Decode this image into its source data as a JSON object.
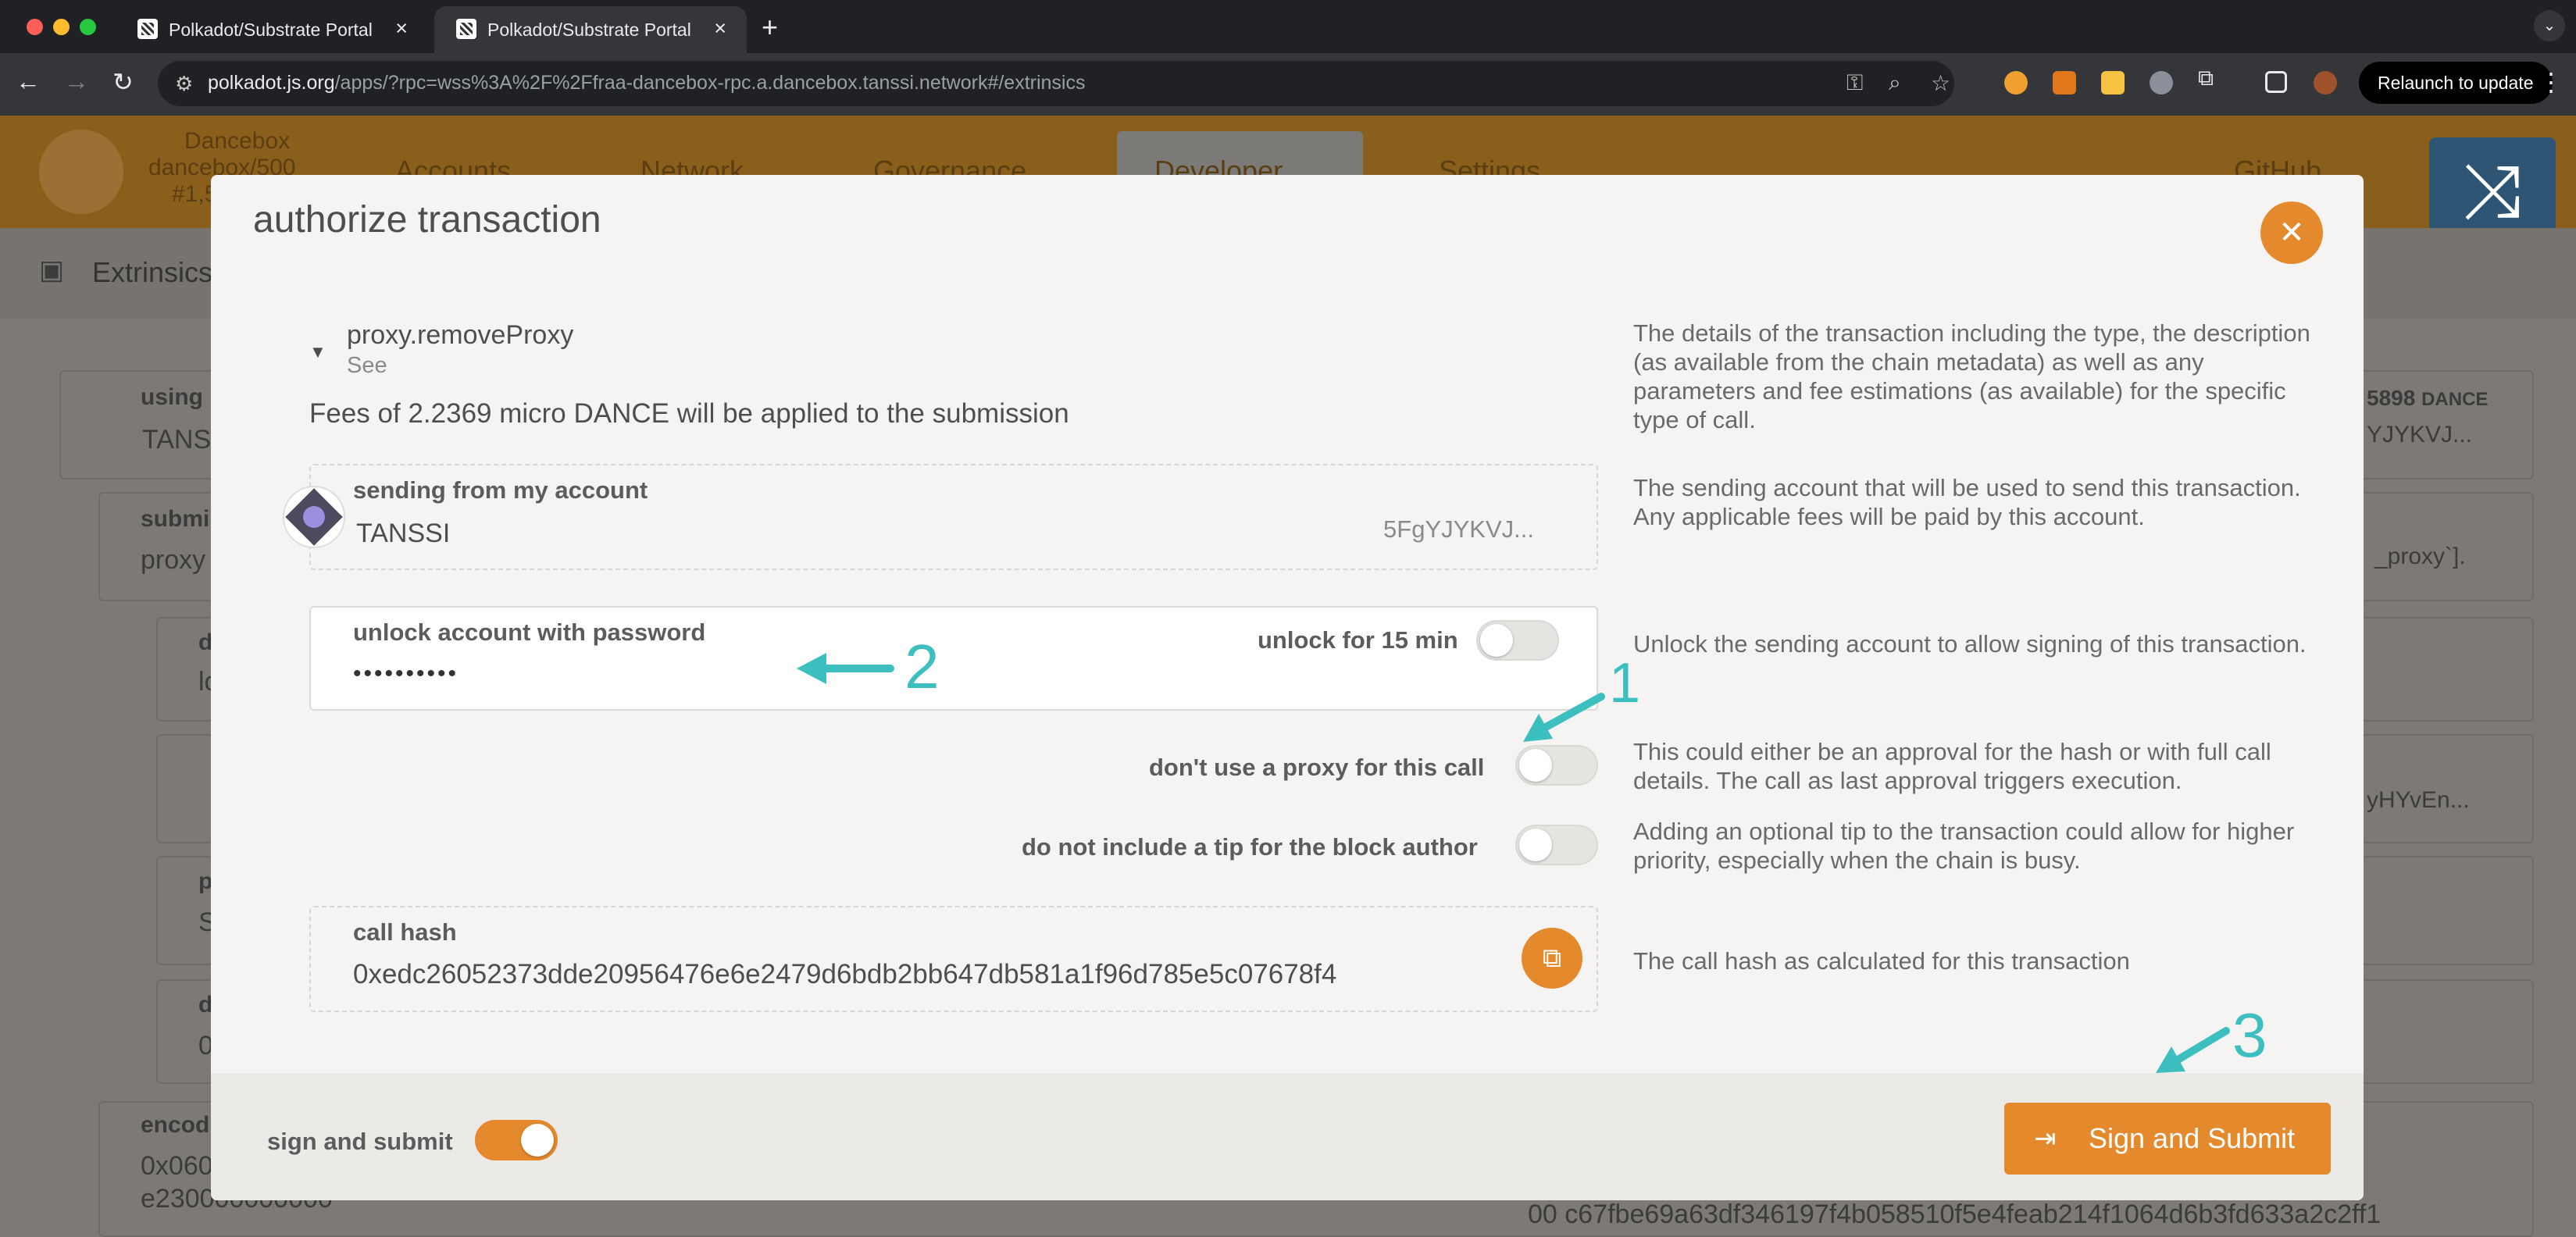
{
  "browser": {
    "tabs": [
      {
        "title": "Polkadot/Substrate Portal",
        "active": false
      },
      {
        "title": "Polkadot/Substrate Portal",
        "active": true
      }
    ],
    "url_host": "polkadot.js.org",
    "url_rest": "/apps/?rpc=wss%3A%2F%2Ffraa-dancebox-rpc.a.dancebox.tanssi.network#/extrinsics",
    "relaunch_label": "Relaunch to update"
  },
  "background_app": {
    "chain_name": "Dancebox",
    "chain_spec": "dancebox/500",
    "chain_block": "#1,5",
    "nav": [
      "Accounts",
      "Network",
      "Governance",
      "Developer",
      "Settings",
      "GitHub"
    ],
    "page_title": "Extrinsics",
    "using_label": "using",
    "using_value": "TANS",
    "balance": "5898",
    "balance_unit": "DANCE",
    "balance_addr": "YJYKVJ...",
    "submit_label": "submi",
    "submit_value": "proxy",
    "proxy_hint": "_proxy`].",
    "d_label": "d",
    "d_value": "lo",
    "addr2": "yHYvEn...",
    "p_label": "p",
    "p_value": "S",
    "d2_label": "d",
    "d2_value": "0",
    "encoded_label": "encod",
    "encoded_value_1": "0x060",
    "encoded_value_2": "e230000000000",
    "hash_tail": "00 c67fbe69a63df346197f4b058510f5e4feab214f1064d6b3fd633a2c2ff1"
  },
  "modal": {
    "title": "authorize transaction",
    "call_name": "proxy.removeProxy",
    "call_see": "See",
    "fees_text": "Fees of 2.2369 micro DANCE will be applied to the submission",
    "help_details": "The details of the transaction including the type, the description (as available from the chain metadata) as well as any parameters and fee estimations (as available) for the specific type of call.",
    "sending_label": "sending from my account",
    "account_name": "TANSSI",
    "account_address": "5FgYJYKVJ...",
    "help_sending": "The sending account that will be used to send this transaction. Any applicable fees will be paid by this account.",
    "unlock_label": "unlock account with password",
    "password_mask": "••••••••••",
    "unlock_for_label": "unlock for 15 min",
    "help_unlock": "Unlock the sending account to allow signing of this transaction.",
    "proxy_label": "don't use a proxy for this call",
    "help_proxy": "This could either be an approval for the hash or with full call details. The call as last approval triggers execution.",
    "tip_label": "do not include a tip for the block author",
    "help_tip": "Adding an optional tip to the transaction could allow for higher priority, especially when the chain is busy.",
    "call_hash_label": "call hash",
    "call_hash_value": "0xedc26052373dde20956476e6e2479d6bdb2bb647db581a1f96d785e5c07678f4",
    "help_hash": "The call hash as calculated for this transaction",
    "sign_submit_toggle_label": "sign and submit",
    "submit_button_label": "Sign and Submit",
    "toggles": {
      "unlock_for": false,
      "no_proxy": false,
      "no_tip": false,
      "sign_and_submit": true
    }
  },
  "annotations": [
    "1",
    "2",
    "3"
  ],
  "colors": {
    "accent": "#e4892c",
    "annotation": "#3dbfbf",
    "shuffle": "#2e5574"
  }
}
